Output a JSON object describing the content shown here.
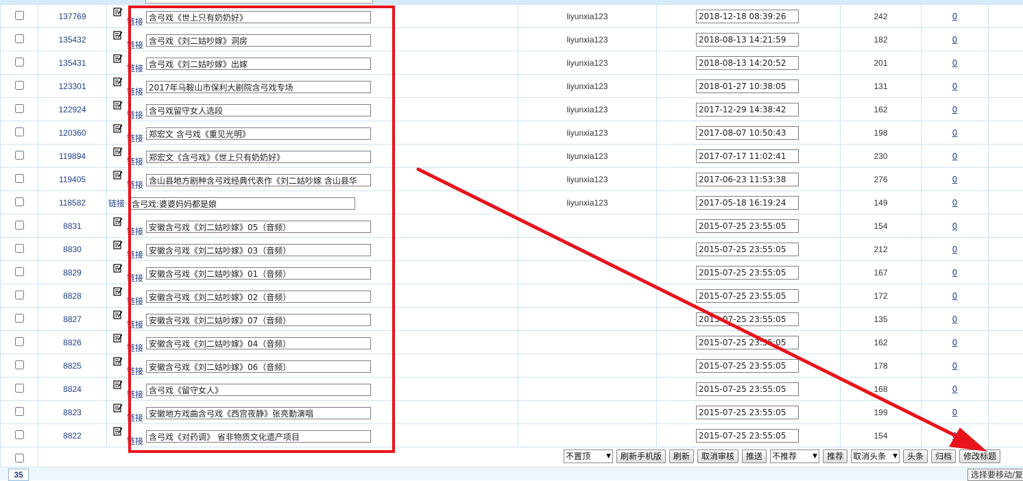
{
  "link_label": "链接",
  "count_link": "0",
  "rows": [
    {
      "id": "137769",
      "title": "含弓戏《世上只有奶奶好》",
      "user": "liyunxia123",
      "date": "2018-12-18 08:39:26",
      "hits": "242",
      "icon": true
    },
    {
      "id": "135432",
      "title": "含弓戏《刘二姑吵嫁》洞房",
      "user": "liyunxia123",
      "date": "2018-08-13 14:21:59",
      "hits": "182",
      "icon": true
    },
    {
      "id": "135431",
      "title": "含弓戏《刘二姑吵嫁》出嫁",
      "user": "liyunxia123",
      "date": "2018-08-13 14:20:52",
      "hits": "201",
      "icon": true
    },
    {
      "id": "123301",
      "title": "2017年马鞍山市保利大剧院含弓戏专场",
      "user": "liyunxia123",
      "date": "2018-01-27 10:38:05",
      "hits": "131",
      "icon": true
    },
    {
      "id": "122924",
      "title": "含弓戏留守女人选段",
      "user": "liyunxia123",
      "date": "2017-12-29 14:38:42",
      "hits": "162",
      "icon": true
    },
    {
      "id": "120360",
      "title": "郑宏文 含弓戏《重见光明》",
      "user": "liyunxia123",
      "date": "2017-08-07 10:50:43",
      "hits": "198",
      "icon": true
    },
    {
      "id": "119894",
      "title": "郑宏文《含弓戏》《世上只有奶奶好》",
      "user": "liyunxia123",
      "date": "2017-07-17 11:02:41",
      "hits": "230",
      "icon": true
    },
    {
      "id": "119405",
      "title": "含山县地方剧种含弓戏经典代表作《刘二姑吵嫁 含山县华",
      "user": "liyunxia123",
      "date": "2017-06-23 11:53:38",
      "hits": "276",
      "icon": true
    },
    {
      "id": "118582",
      "title": "含弓戏:婆婆妈妈都是娘",
      "user": "liyunxia123",
      "date": "2017-05-18 16:19:24",
      "hits": "149",
      "icon": false
    },
    {
      "id": "8831",
      "title": "安徽含弓戏《刘二姑吵嫁》05（音频）",
      "user": "",
      "date": "2015-07-25 23:55:05",
      "hits": "154",
      "icon": true
    },
    {
      "id": "8830",
      "title": "安徽含弓戏《刘二姑吵嫁》03（音频）",
      "user": "",
      "date": "2015-07-25 23:55:05",
      "hits": "212",
      "icon": true
    },
    {
      "id": "8829",
      "title": "安徽含弓戏《刘二姑吵嫁》01（音频）",
      "user": "",
      "date": "2015-07-25 23:55:05",
      "hits": "167",
      "icon": true
    },
    {
      "id": "8828",
      "title": "安徽含弓戏《刘二姑吵嫁》02（音频）",
      "user": "",
      "date": "2015-07-25 23:55:05",
      "hits": "172",
      "icon": true
    },
    {
      "id": "8827",
      "title": "安徽含弓戏《刘二姑吵嫁》07（音频）",
      "user": "",
      "date": "2015-07-25 23:55:05",
      "hits": "135",
      "icon": true
    },
    {
      "id": "8826",
      "title": "安徽含弓戏《刘二姑吵嫁》04（音频）",
      "user": "",
      "date": "2015-07-25 23:55:05",
      "hits": "162",
      "icon": true
    },
    {
      "id": "8825",
      "title": "安徽含弓戏《刘二姑吵嫁》06（音频）",
      "user": "",
      "date": "2015-07-25 23:55:05",
      "hits": "178",
      "icon": true
    },
    {
      "id": "8824",
      "title": "含弓戏《留守女人》",
      "user": "",
      "date": "2015-07-25 23:55:05",
      "hits": "168",
      "icon": true
    },
    {
      "id": "8823",
      "title": "安徽地方戏曲含弓戏《西宫夜静》张亮勤演唱",
      "user": "",
      "date": "2015-07-25 23:55:05",
      "hits": "199",
      "icon": true
    },
    {
      "id": "8822",
      "title": "含弓戏《对药调》 省非物质文化遗产项目",
      "user": "",
      "date": "2015-07-25 23:55:05",
      "hits": "154",
      "icon": true
    }
  ],
  "toolbar": {
    "top_select": "不置顶",
    "refresh_mobile": "刷新手机版",
    "refresh": "刷新",
    "cancel_review": "取消审核",
    "push": "推送",
    "recommend_select": "不推荐",
    "recommend": "推荐",
    "headline_select": "取消头条",
    "headline": "头条",
    "archive": "归档",
    "edit_title": "修改标题"
  },
  "pager": {
    "page": "35"
  },
  "move_label": "选择要移动/复",
  "colors": {
    "annotation": "#e8131b",
    "link": "#1f3f8a",
    "grid_border": "#c9e4f4"
  }
}
